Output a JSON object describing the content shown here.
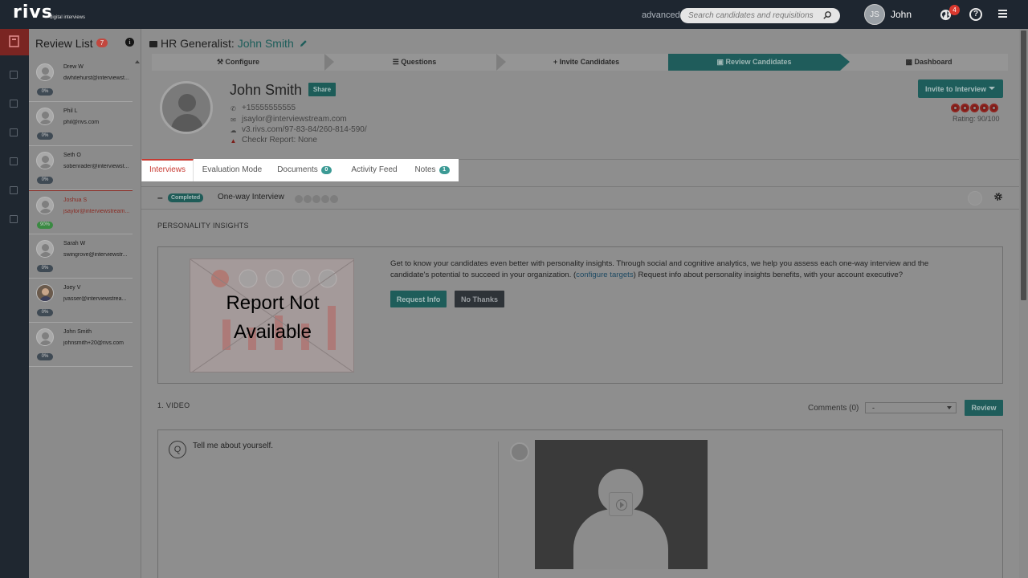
{
  "brand": {
    "name": "rivs",
    "tagline": "digital interviews"
  },
  "topbar": {
    "advanced_label": "advanced",
    "search_placeholder": "Search candidates and requisitions",
    "user_initials": "JS",
    "user_name": "John",
    "notifications_count": "4",
    "help_label": "?"
  },
  "review_list": {
    "title": "Review List",
    "count": "7",
    "info_label": "i",
    "candidates": [
      {
        "name": "Drew W",
        "email": "dwhitehurst@interviewst...",
        "pct": "0%"
      },
      {
        "name": "Phil L",
        "email": "phil@rivs.com",
        "pct": "0%"
      },
      {
        "name": "Seth O",
        "email": "sobenrader@interviewst...",
        "pct": "0%"
      },
      {
        "name": "Joshua S",
        "email": "jsaylor@interviewstream...",
        "pct": "90%"
      },
      {
        "name": "Sarah W",
        "email": "swingrove@interviewstr...",
        "pct": "0%"
      },
      {
        "name": "Joey V",
        "email": "jvasser@interviewstrea...",
        "pct": "0%"
      },
      {
        "name": "John Smith",
        "email": "johnsmith+20@rivs.com",
        "pct": "0%"
      }
    ]
  },
  "job": {
    "prefix": "HR Generalist:",
    "candidate": "John Smith"
  },
  "steps": [
    "Configure",
    "Questions",
    "Invite Candidates",
    "Review Candidates",
    "Dashboard"
  ],
  "profile": {
    "name": "John Smith",
    "share_label": "Share",
    "phone": "+15555555555",
    "email": "jsaylor@interviewstream.com",
    "link": "v3.rivs.com/97-83-84/260-814-590/",
    "checkr": "Checkr Report: None",
    "invite_label": "Invite to Interview",
    "rating_text": "Rating: 90/100",
    "rating_value": 5
  },
  "tabs": [
    {
      "label": "Interviews",
      "badge": ""
    },
    {
      "label": "Evaluation Mode",
      "badge": ""
    },
    {
      "label": "Documents",
      "badge": "0"
    },
    {
      "label": "Activity Feed",
      "badge": ""
    },
    {
      "label": "Notes",
      "badge": "1"
    }
  ],
  "interview": {
    "status": "Completed",
    "type": "One-way Interview"
  },
  "insights": {
    "heading": "PERSONALITY INSIGHTS",
    "report_text_1": "Report Not",
    "report_text_2": "Available",
    "copy_before": "Get to know your candidates even better with personality insights. Through social and cognitive analytics, we help you assess each one-way interview and the candidate's potential to succeed in your organization. (",
    "copy_link": "configure targets",
    "copy_after": ") Request info about personality insights benefits, with your account executive?",
    "request_label": "Request Info",
    "nothanks_label": "No Thanks"
  },
  "video": {
    "heading": "1. VIDEO",
    "comments": "Comments (0)",
    "dropdown_value": "-",
    "review_label": "Review",
    "q_label": "Q",
    "question": "Tell me about yourself."
  }
}
